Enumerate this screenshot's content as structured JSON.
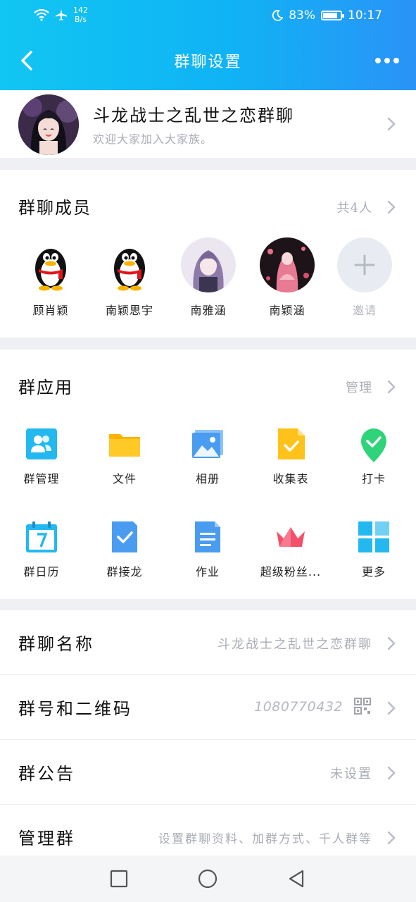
{
  "status_bar": {
    "speed_value": "142",
    "speed_unit": "B/s",
    "battery": "83%",
    "time": "10:17"
  },
  "navbar": {
    "title": "群聊设置"
  },
  "group": {
    "name": "斗龙战士之乱世之恋群聊",
    "description": "欢迎大家加入大家族。"
  },
  "members": {
    "title": "群聊成员",
    "count_label": "共4人",
    "items": [
      {
        "name": "顾肖颖"
      },
      {
        "name": "南颖思宇"
      },
      {
        "name": "南雅涵"
      },
      {
        "name": "南颖涵"
      }
    ],
    "invite_label": "邀请"
  },
  "apps": {
    "title": "群应用",
    "manage_label": "管理",
    "items": [
      {
        "label": "群管理",
        "icon": "group-manage-icon",
        "color": "#23b8f0"
      },
      {
        "label": "文件",
        "icon": "folder-icon",
        "color": "#ffc21a"
      },
      {
        "label": "相册",
        "icon": "photo-album-icon",
        "color": "#4a9cf0"
      },
      {
        "label": "收集表",
        "icon": "form-collect-icon",
        "color": "#ffc21a"
      },
      {
        "label": "打卡",
        "icon": "check-in-icon",
        "color": "#2fd37a"
      },
      {
        "label": "群日历",
        "icon": "calendar-icon",
        "color": "#23b8f0"
      },
      {
        "label": "群接龙",
        "icon": "relay-icon",
        "color": "#4a9cf0"
      },
      {
        "label": "作业",
        "icon": "homework-icon",
        "color": "#4a9cf0"
      },
      {
        "label": "超级粉丝...",
        "icon": "crown-icon",
        "color": "#f2506a"
      },
      {
        "label": "更多",
        "icon": "more-apps-icon",
        "color": "#23b8f0"
      }
    ]
  },
  "settings": {
    "group_name": {
      "label": "群聊名称",
      "value": "斗龙战士之乱世之恋群聊"
    },
    "group_number": {
      "label": "群号和二维码",
      "value": "1080770432"
    },
    "announcement": {
      "label": "群公告",
      "value": "未设置"
    },
    "manage_group": {
      "label": "管理群",
      "value": "设置群聊资料、加群方式、千人群等"
    }
  },
  "colors": {
    "header_start": "#11c6f2",
    "header_end": "#2a93f6",
    "muted_text": "#a9adb6"
  }
}
